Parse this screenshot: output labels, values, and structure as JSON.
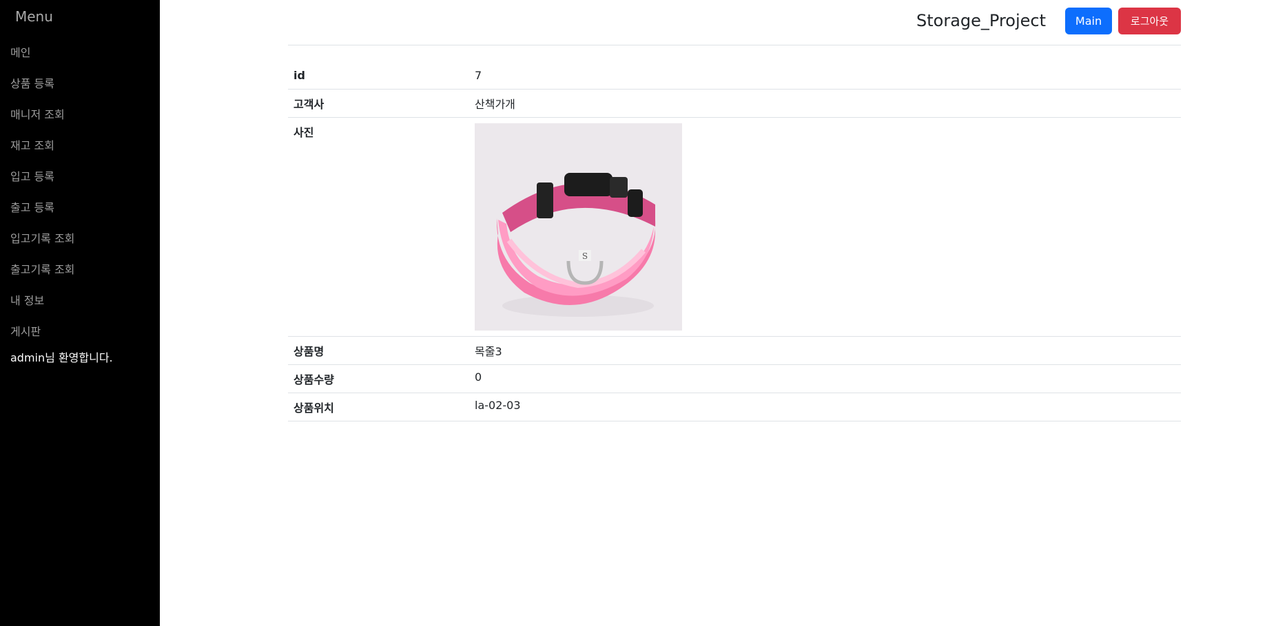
{
  "sidebar": {
    "title": "Menu",
    "items": [
      {
        "label": "메인"
      },
      {
        "label": "상품 등록"
      },
      {
        "label": "매니저 조회"
      },
      {
        "label": "재고 조회"
      },
      {
        "label": "입고 등록"
      },
      {
        "label": "출고 등록"
      },
      {
        "label": "입고기록 조회"
      },
      {
        "label": "출고기록 조회"
      },
      {
        "label": "내 정보"
      },
      {
        "label": "게시판"
      }
    ],
    "welcome": "admin님 환영합니다."
  },
  "header": {
    "title": "Storage_Project",
    "main_button": "Main",
    "logout_button": "로그아웃"
  },
  "detail": {
    "id_label": "id",
    "id_value": "7",
    "customer_label": "고객사",
    "customer_value": "산책가개",
    "photo_label": "사진",
    "photo_tag": "S",
    "name_label": "상품명",
    "name_value": "목줄3",
    "qty_label": "상품수량",
    "qty_value": "0",
    "location_label": "상품위치",
    "location_value": "la-02-03"
  },
  "colors": {
    "sidebar_bg": "#000000",
    "main_button": "#0d6efd",
    "logout_button": "#dc3545",
    "collar_pink": "#f77aaa"
  }
}
